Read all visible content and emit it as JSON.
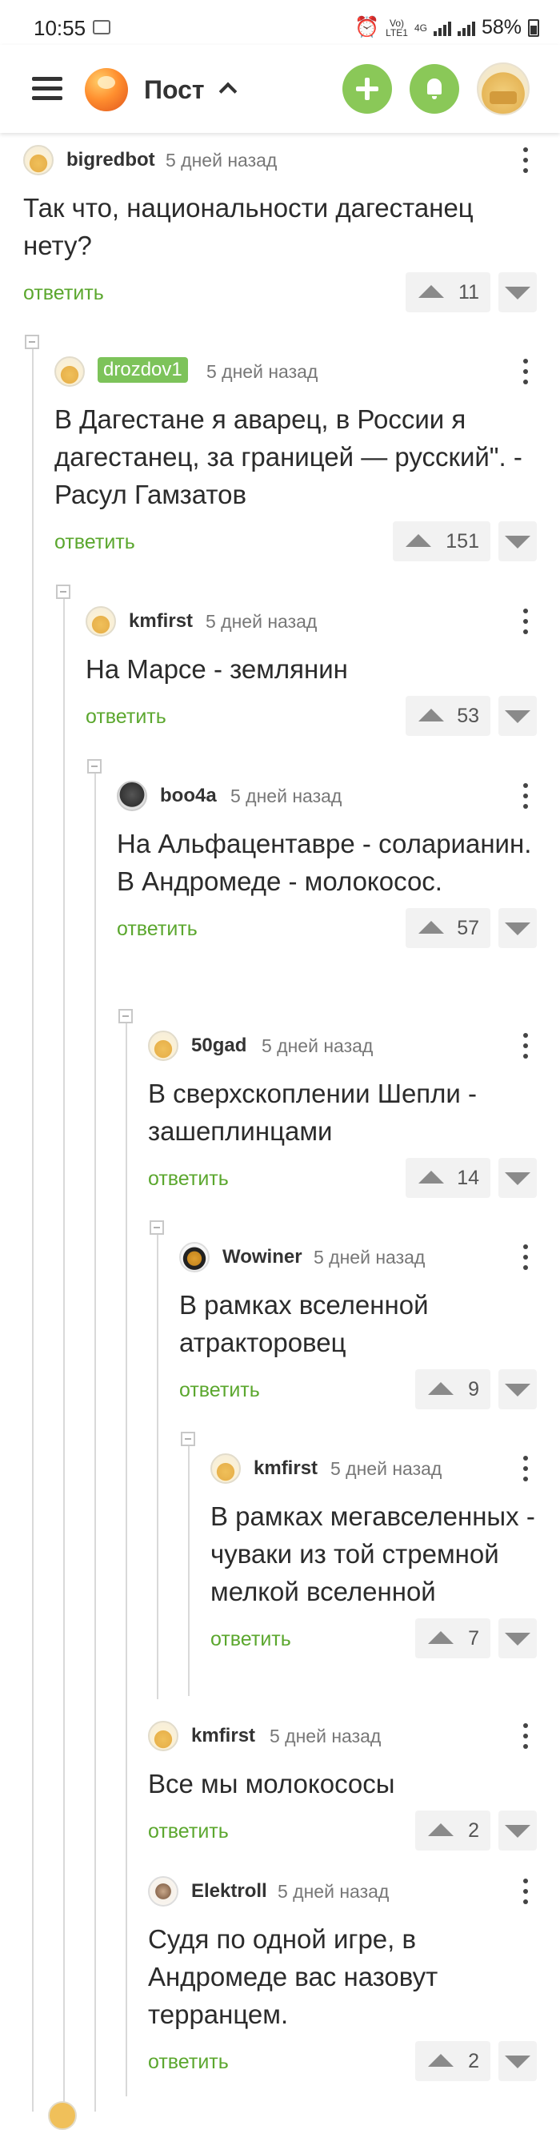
{
  "status_bar": {
    "time": "10:55",
    "carrier_line1": "Vo)",
    "carrier_line2": "LTE1",
    "network": "4G",
    "battery": "58%"
  },
  "header": {
    "title": "Пост",
    "accent_color": "#8ac858"
  },
  "comments": [
    {
      "user": "bigredbot",
      "time": "5 дней назад",
      "text": "Так что, национальности дагестанец нету?",
      "reply": "ответить",
      "votes": "11"
    },
    {
      "user": "drozdov1",
      "time": "5 дней назад",
      "text": "В Дагестане я аварец, в России я дагестанец, за границей — русский\". - Расул Гамзатов",
      "reply": "ответить",
      "votes": "151"
    },
    {
      "user": "kmfirst",
      "time": "5 дней назад",
      "text": "На Марсе - землянин",
      "reply": "ответить",
      "votes": "53"
    },
    {
      "user": "boo4a",
      "time": "5 дней назад",
      "text": "На Альфацентавре - соларианин. В Андромеде - молокосос.",
      "reply": "ответить",
      "votes": "57"
    },
    {
      "user": "50gad",
      "time": "5 дней назад",
      "text": "В сверхскоплении Шепли - зашеплинцами",
      "reply": "ответить",
      "votes": "14"
    },
    {
      "user": "Wowiner",
      "time": "5 дней назад",
      "text": "В рамках вселенной атракторовец",
      "reply": "ответить",
      "votes": "9"
    },
    {
      "user": "kmfirst",
      "time": "5 дней назад",
      "text": "В рамках мегавселенных - чуваки из той стремной мелкой вселенной",
      "reply": "ответить",
      "votes": "7"
    },
    {
      "user": "kmfirst",
      "time": "5 дней назад",
      "text": "Все мы молокососы",
      "reply": "ответить",
      "votes": "2"
    },
    {
      "user": "Elektroll",
      "time": "5 дней назад",
      "text": "Судя по одной игре, в Андромеде вас назовут терранцем.",
      "reply": "ответить",
      "votes": "2"
    }
  ]
}
